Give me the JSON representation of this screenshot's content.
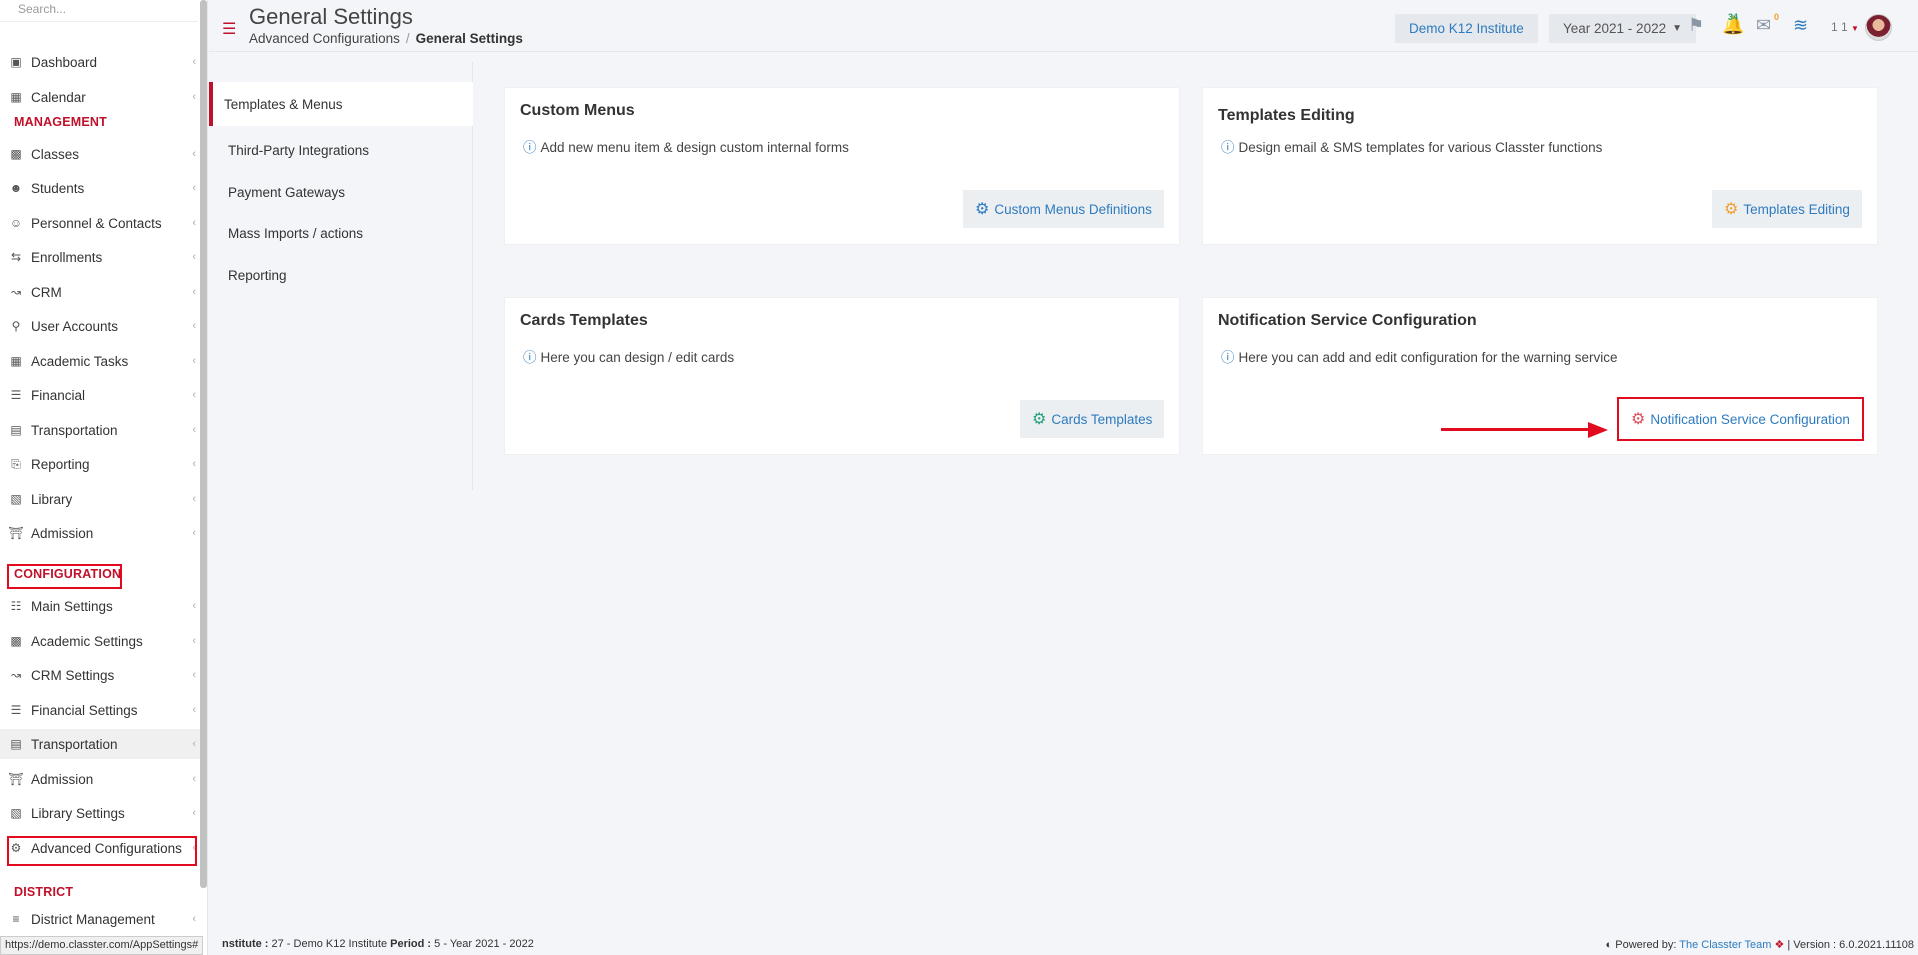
{
  "sidebar": {
    "search_placeholder": "Search...",
    "items_top": [
      {
        "label": "Dashboard",
        "icon": "laptop-icon"
      },
      {
        "label": "Calendar",
        "icon": "calendar-icon"
      }
    ],
    "section_management": "MANAGEMENT",
    "items_management": [
      {
        "label": "Classes",
        "icon": "classes-icon"
      },
      {
        "label": "Students",
        "icon": "students-icon"
      },
      {
        "label": "Personnel & Contacts",
        "icon": "personnel-icon"
      },
      {
        "label": "Enrollments",
        "icon": "enrollments-icon"
      },
      {
        "label": "CRM",
        "icon": "crm-icon"
      },
      {
        "label": "User Accounts",
        "icon": "key-icon"
      },
      {
        "label": "Academic Tasks",
        "icon": "tasks-icon"
      },
      {
        "label": "Financial",
        "icon": "financial-icon"
      },
      {
        "label": "Transportation",
        "icon": "bus-icon"
      },
      {
        "label": "Reporting",
        "icon": "printer-icon"
      },
      {
        "label": "Library",
        "icon": "library-icon"
      },
      {
        "label": "Admission",
        "icon": "bank-icon"
      }
    ],
    "section_configuration": "CONFIGURATION",
    "items_configuration": [
      {
        "label": "Main Settings",
        "icon": "sliders-icon"
      },
      {
        "label": "Academic Settings",
        "icon": "academic-icon"
      },
      {
        "label": "CRM Settings",
        "icon": "crm-icon"
      },
      {
        "label": "Financial Settings",
        "icon": "financial-icon"
      },
      {
        "label": "Transportation",
        "icon": "bus-icon"
      },
      {
        "label": "Admission",
        "icon": "bank-icon"
      },
      {
        "label": "Library Settings",
        "icon": "library-icon"
      },
      {
        "label": "Advanced Configurations",
        "icon": "gears-icon"
      }
    ],
    "section_district": "DISTRICT",
    "items_district": [
      {
        "label": "District Management",
        "icon": "list-icon"
      }
    ]
  },
  "header": {
    "title": "General Settings",
    "breadcrumb_parent": "Advanced Configurations",
    "breadcrumb_sep": "/",
    "breadcrumb_current": "General Settings",
    "institute": "Demo K12 Institute",
    "year": "Year 2021 - 2022",
    "notifications_count": "34",
    "messages_count": "0",
    "user_label": "1 1"
  },
  "settings_nav": [
    "Templates & Menus",
    "Third-Party Integrations",
    "Payment Gateways",
    "Mass Imports / actions",
    "Reporting"
  ],
  "cards": {
    "custom_menus": {
      "title": "Custom Menus",
      "desc": "Add new menu item & design custom internal forms",
      "button": "Custom Menus Definitions",
      "button_color": "#2e7bbf"
    },
    "templates_editing": {
      "title": "Templates Editing",
      "desc": "Design email & SMS templates for various Classter functions",
      "button": "Templates Editing",
      "button_color": "#f0a030"
    },
    "cards_templates": {
      "title": "Cards Templates",
      "desc": "Here you can design / edit cards",
      "button": "Cards Templates",
      "button_color": "#26a17a"
    },
    "notification_service": {
      "title": "Notification Service Configuration",
      "desc": "Here you can add and edit configuration for the warning service",
      "button": "Notification Service Configuration",
      "button_color": "#e0505a"
    }
  },
  "footer": {
    "status_url": "https://demo.classter.com/AppSettings#",
    "institute_prefix": "nstitute :",
    "institute_value": "27 - Demo K12 Institute",
    "period_label": "Period :",
    "period_value": "5 - Year 2021 - 2022",
    "powered_by": "Powered by:",
    "team": "The Classter Team",
    "version": "| Version : 6.0.2021.11108"
  },
  "colors": {
    "brand_red": "#c0102a",
    "link_blue": "#2e7bbf",
    "highlight_red": "#e10a1e"
  }
}
